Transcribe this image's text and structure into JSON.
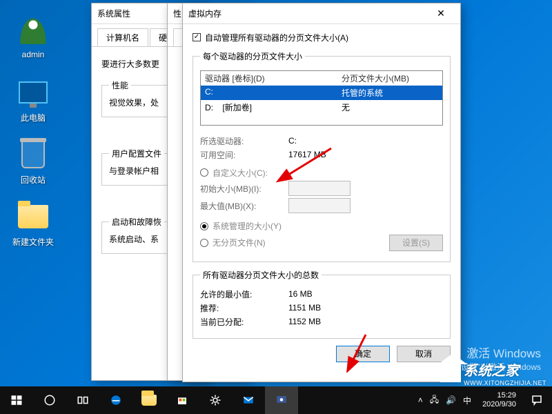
{
  "desktop": {
    "icons": [
      {
        "name": "admin",
        "label": "admin",
        "type": "user"
      },
      {
        "name": "this-pc",
        "label": "此电脑",
        "type": "pc"
      },
      {
        "name": "recycle-bin",
        "label": "回收站",
        "type": "bin"
      },
      {
        "name": "new-folder",
        "label": "新建文件夹",
        "type": "folder"
      }
    ]
  },
  "window_sysprops": {
    "title": "系统属性",
    "tabs": [
      "计算机名",
      "硬件"
    ],
    "intro": "要进行大多数更",
    "groups": {
      "perf": {
        "legend": "性能",
        "text": "视觉效果，处"
      },
      "user": {
        "legend": "用户配置文件",
        "text": "与登录帐户相"
      },
      "boot": {
        "legend": "启动和故障恢",
        "text": "系统启动、系"
      }
    }
  },
  "window_perf": {
    "title": "性",
    "tab": "视"
  },
  "window_vm": {
    "title": "虚拟内存",
    "auto_manage": "自动管理所有驱动器的分页文件大小(A)",
    "group_each": "每个驱动器的分页文件大小",
    "col_drive": "驱动器 [卷标](D)",
    "col_page": "分页文件大小(MB)",
    "drives": [
      {
        "id": "C:",
        "vol": "",
        "size": "托管的系统",
        "selected": true
      },
      {
        "id": "D:",
        "vol": "[新加卷]",
        "size": "无",
        "selected": false
      }
    ],
    "selected_drive_label": "所选驱动器:",
    "selected_drive_value": "C:",
    "free_space_label": "可用空间:",
    "free_space_value": "17617 MB",
    "custom_size": "自定义大小(C):",
    "initial_label": "初始大小(MB)(I):",
    "max_label": "最大值(MB)(X):",
    "system_managed": "系统管理的大小(Y)",
    "no_paging": "无分页文件(N)",
    "set_btn": "设置(S)",
    "totals_legend": "所有驱动器分页文件大小的总数",
    "min_label": "允许的最小值:",
    "min_value": "16 MB",
    "rec_label": "推荐:",
    "rec_value": "1151 MB",
    "cur_label": "当前已分配:",
    "cur_value": "1152 MB",
    "ok": "确定",
    "cancel": "取消"
  },
  "watermark": {
    "l1": "激活 Windows",
    "l2": "转到\"设置\"以激活 Windows"
  },
  "brand": "系统之家",
  "brand_url": "WWW.XITONGZHIJIA.NET",
  "taskbar": {
    "time": "15:29",
    "date": "2020/9/30"
  }
}
